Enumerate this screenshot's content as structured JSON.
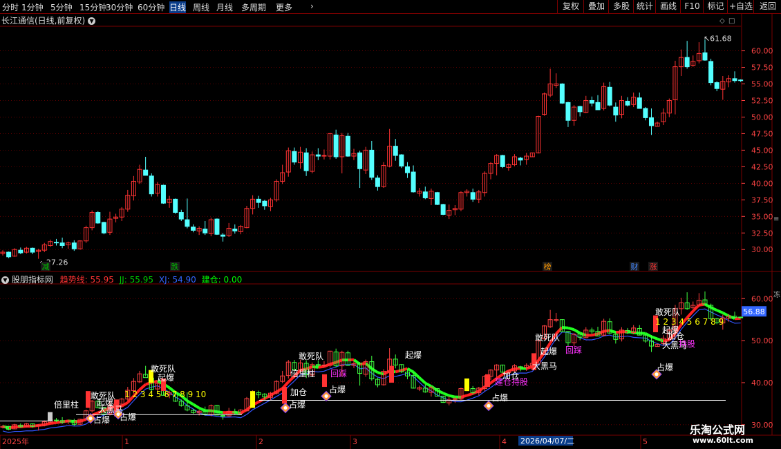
{
  "toolbar": {
    "tabs": [
      "分时",
      "1分钟",
      "5分钟",
      "15分钟",
      "30分钟",
      "60分钟",
      "日线",
      "周线",
      "月线",
      "多周期",
      "更多"
    ],
    "selected": "日线",
    "right_buttons": [
      "复权",
      "叠加",
      "多股",
      "统计",
      "画线",
      "F10",
      "标记",
      "+自选",
      "返回"
    ]
  },
  "main_header": {
    "title": "长江通信(日线,前复权)"
  },
  "price_axis": {
    "ticks": [
      "60.00",
      "57.50",
      "55.00",
      "52.50",
      "50.00",
      "47.50",
      "45.00",
      "42.50",
      "40.00",
      "37.50",
      "35.00",
      "32.50",
      "30.00"
    ],
    "range": [
      27.0,
      63.5
    ]
  },
  "annotations": {
    "high": "61.68",
    "low": "27.26"
  },
  "event_tags": [
    {
      "text": "减",
      "color": "#00c000"
    },
    {
      "text": "跌",
      "color": "#00c000"
    },
    {
      "text": "榜",
      "color": "#ff9900"
    },
    {
      "text": "财",
      "color": "#4488ff"
    },
    {
      "text": "涨",
      "color": "#ff3333"
    }
  ],
  "indicator": {
    "name": "股朋指标网",
    "values": [
      {
        "label": "趋势线: 55.95",
        "color": "#ff3333"
      },
      {
        "label": "JJ: 55.95",
        "color": "#00cc00"
      },
      {
        "label": "XJ: 54.90",
        "color": "#3366ff"
      },
      {
        "label": "建仓: 0.00",
        "color": "#00ff00"
      }
    ],
    "axis_ticks": [
      "60.00",
      "50.00",
      "40.00",
      "30.00"
    ],
    "range": [
      28,
      63
    ],
    "current_value": "56.88",
    "current_color": "#3366ff"
  },
  "indicator_labels": [
    {
      "text": "倍里柱",
      "color": "#ffffff"
    },
    {
      "text": "敢死队",
      "color": "#ffffff"
    },
    {
      "text": "起爆",
      "color": "#ffffff"
    },
    {
      "text": "大黑马",
      "color": "#ffffff"
    },
    {
      "text": "占爆",
      "color": "#ffffff"
    },
    {
      "text": "敢死队",
      "color": "#ffffff"
    },
    {
      "text": "起爆",
      "color": "#ffffff"
    },
    {
      "text": "1 2 3 4 5 6 7 8 9 10",
      "color": "#ffff00"
    },
    {
      "text": "占爆",
      "color": "#ffffff"
    },
    {
      "text": "倍里柱",
      "color": "#ffffff"
    },
    {
      "text": "加仓",
      "color": "#ffffff"
    },
    {
      "text": "占爆",
      "color": "#ffffff"
    },
    {
      "text": "敢死队",
      "color": "#ffffff"
    },
    {
      "text": "回踩",
      "color": "#ff33ff"
    },
    {
      "text": "起爆",
      "color": "#ffffff"
    },
    {
      "text": "占爆",
      "color": "#ffffff"
    },
    {
      "text": "建仓持股",
      "color": "#ff33ff"
    },
    {
      "text": "加仓",
      "color": "#ffffff"
    },
    {
      "text": "大黑马",
      "color": "#ffffff"
    },
    {
      "text": "占爆",
      "color": "#ffffff"
    },
    {
      "text": "敢死队",
      "color": "#ffffff"
    },
    {
      "text": "起爆",
      "color": "#ffffff"
    },
    {
      "text": "回踩",
      "color": "#ff33ff"
    },
    {
      "text": "敢死队",
      "color": "#ffffff"
    },
    {
      "text": "1 2 3 4 5 6 7 8 9",
      "color": "#ffff00"
    },
    {
      "text": "起爆",
      "color": "#ffffff"
    },
    {
      "text": "加仓",
      "color": "#ffffff"
    },
    {
      "text": "大黑马",
      "color": "#ffffff"
    },
    {
      "text": "持股",
      "color": "#ff33ff"
    },
    {
      "text": "占爆",
      "color": "#ffffff"
    }
  ],
  "date_axis": {
    "labels": [
      "2025年",
      "1",
      "2",
      "3",
      "4",
      "5"
    ],
    "highlight": "2026/04/07/二"
  },
  "watermark": {
    "line1": "乐淘公式网",
    "line2": "www.60lt.com"
  },
  "colors": {
    "up": "#ff3333",
    "down": "#54ffff",
    "grid": "#7a0000",
    "axis_text": "#ff4444"
  },
  "candles": [
    [
      29.4,
      29.9,
      29.1,
      29.6
    ],
    [
      29.6,
      29.7,
      28.7,
      28.9
    ],
    [
      29.0,
      30.2,
      28.9,
      30.0
    ],
    [
      29.9,
      30.3,
      29.3,
      29.5
    ],
    [
      29.6,
      30.4,
      29.4,
      30.2
    ],
    [
      30.2,
      30.3,
      29.3,
      29.6
    ],
    [
      29.7,
      30.1,
      28.6,
      29.9
    ],
    [
      29.9,
      31.0,
      29.6,
      30.7
    ],
    [
      30.6,
      31.5,
      30.4,
      31.2
    ],
    [
      31.1,
      31.6,
      30.6,
      31.0
    ],
    [
      31.0,
      31.8,
      30.2,
      30.6
    ],
    [
      30.7,
      31.2,
      30.1,
      31.0
    ],
    [
      31.0,
      31.4,
      29.8,
      30.1
    ],
    [
      30.1,
      31.4,
      30.0,
      31.3
    ],
    [
      31.3,
      33.6,
      31.0,
      33.3
    ],
    [
      33.3,
      35.9,
      32.9,
      35.6
    ],
    [
      35.6,
      35.8,
      33.9,
      34.0
    ],
    [
      34.1,
      34.2,
      32.3,
      32.5
    ],
    [
      32.6,
      35.7,
      32.2,
      34.6
    ],
    [
      34.7,
      35.4,
      34.1,
      34.9
    ],
    [
      34.9,
      36.4,
      34.3,
      36.1
    ],
    [
      36.1,
      39.0,
      35.7,
      38.2
    ],
    [
      38.1,
      41.1,
      37.4,
      40.3
    ],
    [
      40.2,
      42.8,
      39.9,
      42.1
    ],
    [
      42.0,
      44.0,
      41.5,
      41.2
    ],
    [
      41.1,
      41.5,
      38.0,
      38.4
    ],
    [
      38.5,
      40.2,
      38.0,
      39.8
    ],
    [
      39.7,
      39.8,
      36.9,
      37.0
    ],
    [
      37.1,
      38.1,
      36.3,
      37.6
    ],
    [
      37.6,
      37.7,
      35.4,
      35.6
    ],
    [
      35.6,
      36.0,
      34.3,
      34.6
    ],
    [
      34.5,
      37.7,
      33.2,
      33.5
    ],
    [
      33.4,
      33.8,
      32.6,
      32.9
    ],
    [
      32.8,
      33.5,
      32.2,
      33.2
    ],
    [
      33.1,
      34.3,
      32.2,
      32.5
    ],
    [
      32.4,
      34.8,
      32.0,
      34.5
    ],
    [
      34.6,
      34.7,
      32.2,
      32.3
    ],
    [
      32.2,
      32.5,
      31.2,
      32.0
    ],
    [
      32.1,
      34.0,
      31.9,
      33.2
    ],
    [
      33.1,
      33.8,
      32.4,
      32.8
    ],
    [
      32.7,
      33.7,
      32.3,
      33.5
    ],
    [
      33.3,
      36.6,
      33.2,
      36.2
    ],
    [
      36.2,
      38.2,
      35.3,
      37.6
    ],
    [
      37.6,
      38.1,
      36.3,
      37.1
    ],
    [
      37.3,
      37.5,
      36.0,
      36.6
    ],
    [
      36.5,
      37.8,
      35.8,
      37.5
    ],
    [
      37.5,
      40.6,
      37.2,
      40.3
    ],
    [
      40.3,
      42.8,
      39.9,
      41.6
    ],
    [
      41.7,
      45.4,
      41.0,
      44.9
    ],
    [
      44.8,
      45.4,
      42.8,
      43.2
    ],
    [
      43.1,
      45.5,
      42.2,
      44.7
    ],
    [
      44.6,
      45.3,
      41.1,
      41.9
    ],
    [
      41.8,
      44.8,
      41.5,
      44.3
    ],
    [
      44.3,
      45.3,
      43.5,
      44.1
    ],
    [
      44.2,
      45.1,
      43.6,
      44.2
    ],
    [
      44.1,
      47.6,
      43.6,
      47.5
    ],
    [
      47.3,
      48.1,
      43.7,
      44.0
    ],
    [
      44.0,
      47.6,
      41.5,
      47.2
    ],
    [
      47.1,
      47.6,
      44.0,
      44.1
    ],
    [
      44.1,
      45.2,
      43.5,
      44.5
    ],
    [
      44.6,
      44.9,
      39.3,
      42.2
    ],
    [
      42.0,
      45.5,
      41.4,
      45.0
    ],
    [
      45.0,
      46.4,
      40.5,
      40.9
    ],
    [
      40.8,
      41.2,
      38.9,
      39.5
    ],
    [
      39.5,
      43.2,
      39.3,
      42.7
    ],
    [
      42.6,
      48.2,
      42.4,
      45.6
    ],
    [
      45.6,
      46.7,
      43.4,
      44.2
    ],
    [
      44.3,
      44.4,
      42.3,
      42.6
    ],
    [
      42.5,
      43.2,
      40.8,
      41.6
    ],
    [
      41.7,
      42.7,
      38.6,
      38.7
    ],
    [
      38.5,
      39.3,
      38.0,
      38.8
    ],
    [
      38.7,
      39.5,
      37.6,
      37.8
    ],
    [
      37.7,
      39.2,
      36.7,
      38.8
    ],
    [
      38.6,
      38.7,
      36.7,
      36.8
    ],
    [
      36.8,
      36.9,
      35.2,
      35.3
    ],
    [
      35.2,
      36.8,
      34.6,
      35.9
    ],
    [
      36.0,
      36.7,
      35.2,
      36.2
    ],
    [
      36.1,
      38.8,
      35.8,
      38.6
    ],
    [
      38.6,
      39.1,
      38.0,
      38.8
    ],
    [
      38.6,
      39.2,
      37.2,
      37.6
    ],
    [
      37.6,
      39.0,
      37.0,
      38.7
    ],
    [
      38.6,
      41.8,
      38.0,
      41.5
    ],
    [
      41.5,
      43.2,
      40.6,
      43.0
    ],
    [
      43.0,
      44.4,
      41.2,
      44.2
    ],
    [
      44.2,
      44.3,
      42.3,
      42.5
    ],
    [
      42.4,
      43.0,
      41.9,
      42.8
    ],
    [
      42.8,
      44.4,
      42.6,
      44.0
    ],
    [
      43.8,
      44.0,
      42.7,
      43.5
    ],
    [
      43.6,
      44.6,
      42.8,
      44.1
    ],
    [
      44.0,
      44.6,
      44.0,
      44.6
    ],
    [
      44.6,
      50.2,
      44.5,
      50.1
    ],
    [
      50.4,
      53.7,
      50.2,
      53.5
    ],
    [
      53.3,
      57.3,
      53.0,
      55.0
    ],
    [
      54.8,
      56.6,
      54.4,
      55.0
    ],
    [
      55.0,
      55.1,
      52.0,
      52.1
    ],
    [
      52.2,
      52.3,
      48.5,
      49.5
    ],
    [
      49.5,
      51.8,
      48.7,
      51.5
    ],
    [
      51.6,
      51.7,
      50.1,
      50.8
    ],
    [
      50.7,
      53.2,
      50.6,
      52.5
    ],
    [
      52.5,
      53.1,
      51.6,
      52.1
    ],
    [
      52.2,
      53.3,
      51.1,
      51.1
    ],
    [
      51.3,
      55.2,
      51.0,
      54.6
    ],
    [
      54.5,
      55.3,
      51.6,
      51.8
    ],
    [
      51.5,
      52.2,
      49.3,
      50.3
    ],
    [
      50.4,
      53.2,
      49.8,
      52.5
    ],
    [
      52.4,
      53.0,
      51.6,
      51.8
    ],
    [
      51.9,
      53.7,
      51.5,
      53.0
    ],
    [
      52.9,
      53.7,
      51.3,
      51.3
    ],
    [
      51.3,
      51.5,
      49.5,
      49.9
    ],
    [
      49.9,
      51.3,
      47.3,
      48.7
    ],
    [
      48.6,
      49.3,
      48.6,
      49.1
    ],
    [
      49.3,
      51.3,
      48.8,
      50.6
    ],
    [
      50.6,
      52.8,
      50.0,
      52.5
    ],
    [
      52.6,
      58.5,
      50.4,
      57.6
    ],
    [
      57.6,
      60.2,
      56.2,
      59.0
    ],
    [
      59.0,
      61.5,
      57.3,
      57.6
    ],
    [
      57.8,
      59.3,
      57.6,
      58.4
    ],
    [
      58.5,
      61.3,
      58.1,
      59.6
    ],
    [
      59.7,
      61.7,
      58.5,
      58.6
    ],
    [
      58.4,
      58.8,
      54.8,
      55.2
    ],
    [
      55.2,
      55.4,
      53.9,
      54.3
    ],
    [
      54.2,
      56.2,
      52.6,
      55.4
    ],
    [
      55.3,
      56.3,
      54.5,
      55.8
    ],
    [
      55.8,
      56.9,
      55.2,
      55.5
    ],
    [
      55.6,
      55.7,
      55.3,
      55.5
    ]
  ]
}
